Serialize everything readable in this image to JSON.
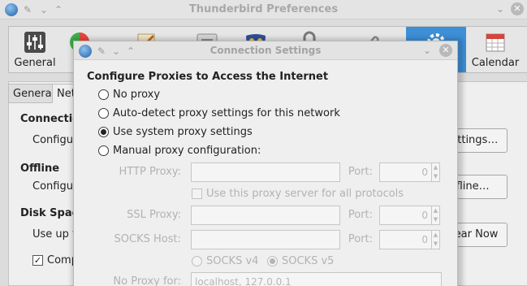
{
  "background_window": {
    "title": "Thunderbird Preferences",
    "toolbar": [
      {
        "label": "General",
        "icon": "switches-icon"
      },
      {
        "label": "D",
        "icon": "display-icon"
      },
      {
        "label": "",
        "icon": "composition-icon"
      },
      {
        "label": "",
        "icon": "chat-icon"
      },
      {
        "label": "",
        "icon": "privacy-mask-icon"
      },
      {
        "label": "",
        "icon": "security-lock-icon"
      },
      {
        "label": "",
        "icon": "attachments-icon"
      },
      {
        "label": "",
        "icon": "advanced-gear-icon"
      },
      {
        "label": "Calendar",
        "icon": "calendar-icon"
      }
    ],
    "subtabs": [
      "General",
      "Net"
    ],
    "sections": {
      "connection": {
        "title": "Connection",
        "text": "Configure",
        "button": "Settings…"
      },
      "offline": {
        "title": "Offline",
        "text": "Configure",
        "button": "Offline…"
      },
      "disk_space": {
        "title": "Disk Space",
        "text": "Use up t",
        "button": "Clear Now",
        "checkbox_label": "Comp",
        "checkbox_checked": true
      }
    }
  },
  "dialog": {
    "title": "Connection Settings",
    "heading": "Configure Proxies to Access the Internet",
    "proxy_options": [
      {
        "label": "No proxy",
        "checked": false
      },
      {
        "label": "Auto-detect proxy settings for this network",
        "checked": false
      },
      {
        "label": "Use system proxy settings",
        "checked": true
      },
      {
        "label": "Manual proxy configuration:",
        "checked": false
      }
    ],
    "manual": {
      "http_label": "HTTP Proxy:",
      "http_value": "",
      "http_port_label": "Port:",
      "http_port": "0",
      "use_same_label": "Use this proxy server for all protocols",
      "ssl_label": "SSL Proxy:",
      "ssl_value": "",
      "ssl_port_label": "Port:",
      "ssl_port": "0",
      "socks_label": "SOCKS Host:",
      "socks_value": "",
      "socks_port_label": "Port:",
      "socks_port": "0",
      "socks_v4": "SOCKS v4",
      "socks_v5": "SOCKS v5",
      "socks_v5_checked": true,
      "no_proxy_label": "No Proxy for:",
      "no_proxy_value": "localhost, 127.0.0.1"
    }
  },
  "colors": {
    "accent": "#3d8fd6",
    "disabled_text": "#b2b2b2"
  }
}
